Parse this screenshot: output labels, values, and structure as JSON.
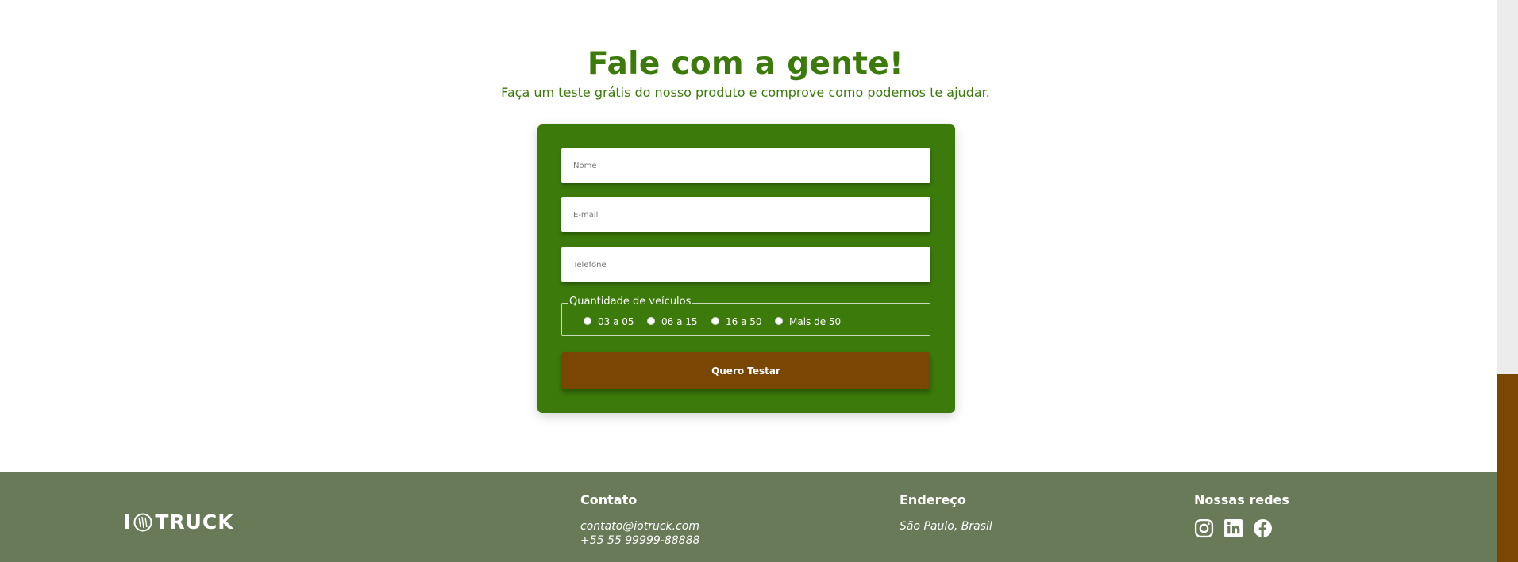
{
  "hero": {
    "title": "Fale com a gente!",
    "subtitle": "Faça um teste grátis do nosso produto e comprove como podemos te ajudar."
  },
  "form": {
    "name_placeholder": "Nome",
    "email_placeholder": "E-mail",
    "phone_placeholder": "Telefone",
    "vehicles_legend": "Quantidade de veículos",
    "vehicle_options": [
      "03 a 05",
      "06 a 15",
      "16 a 50",
      "Mais de 50"
    ],
    "submit_label": "Quero Testar"
  },
  "footer": {
    "logo_left": "I",
    "logo_right": "TRUCK",
    "logo_icon": "tire-icon",
    "contact_title": "Contato",
    "contact_email": "contato@iotruck.com",
    "contact_phone": "+55 55 99999-88888",
    "address_title": "Endereço",
    "address_text": "São Paulo, Brasil",
    "social_title": "Nossas redes",
    "social_icons": [
      "instagram-icon",
      "linkedin-icon",
      "facebook-icon"
    ]
  },
  "colors": {
    "brand_green": "#3b7a0b",
    "button_brown": "#7a4604",
    "footer_green": "#687a58"
  }
}
